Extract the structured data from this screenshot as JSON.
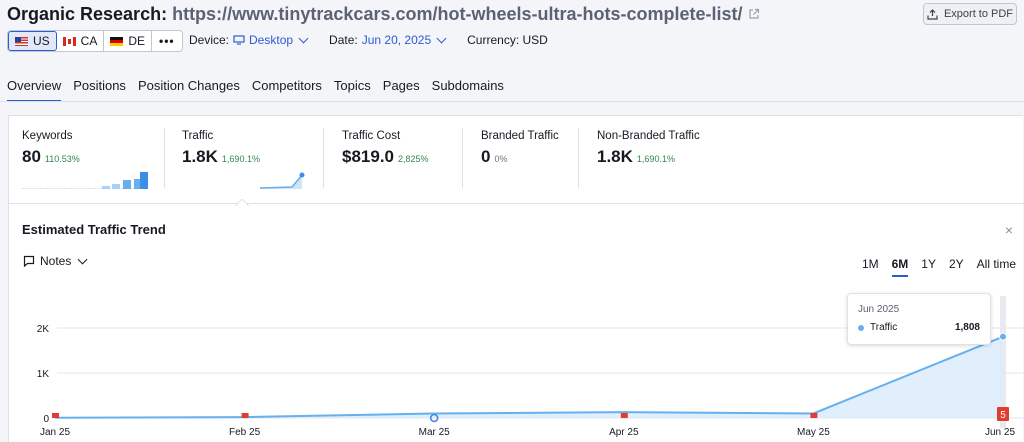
{
  "header": {
    "title": "Organic Research:",
    "url": "https://www.tinytrackcars.com/hot-wheels-ultra-hots-complete-list/",
    "export_label": "Export to PDF"
  },
  "databases": [
    {
      "code": "US",
      "active": true
    },
    {
      "code": "CA",
      "active": false
    },
    {
      "code": "DE",
      "active": false
    }
  ],
  "more_label": "•••",
  "filters": {
    "device_label": "Device:",
    "device_value": "Desktop",
    "date_label": "Date:",
    "date_value": "Jun 20, 2025",
    "currency": "Currency: USD"
  },
  "tabs": [
    "Overview",
    "Positions",
    "Position Changes",
    "Competitors",
    "Topics",
    "Pages",
    "Subdomains"
  ],
  "metrics": [
    {
      "label": "Keywords",
      "value": "80",
      "change": "110.53%"
    },
    {
      "label": "Traffic",
      "value": "1.8K",
      "change": "1,690.1%"
    },
    {
      "label": "Traffic Cost",
      "value": "$819.0",
      "change": "2,825%"
    },
    {
      "label": "Branded Traffic",
      "value": "0",
      "change": "0%"
    },
    {
      "label": "Non-Branded Traffic",
      "value": "1.8K",
      "change": "1,690.1%"
    }
  ],
  "trend": {
    "title": "Estimated Traffic Trend",
    "close": "×",
    "notes_label": "Notes",
    "ranges": [
      "1M",
      "6M",
      "1Y",
      "2Y",
      "All time"
    ],
    "active_range": "6M"
  },
  "tooltip": {
    "date": "Jun 2025",
    "series": "Traffic",
    "value": "1,808"
  },
  "chart_data": {
    "type": "area",
    "x": [
      "Jan 25",
      "Feb 25",
      "Mar 25",
      "Apr 25",
      "May 25",
      "Jun 25"
    ],
    "series": [
      {
        "name": "Traffic",
        "values": [
          5,
          20,
          100,
          130,
          101,
          1808
        ]
      }
    ],
    "yticks": [
      "0",
      "1K",
      "2K"
    ],
    "ylim": [
      0,
      2000
    ],
    "note_badge": "5",
    "line_color": "#66b0ee"
  }
}
